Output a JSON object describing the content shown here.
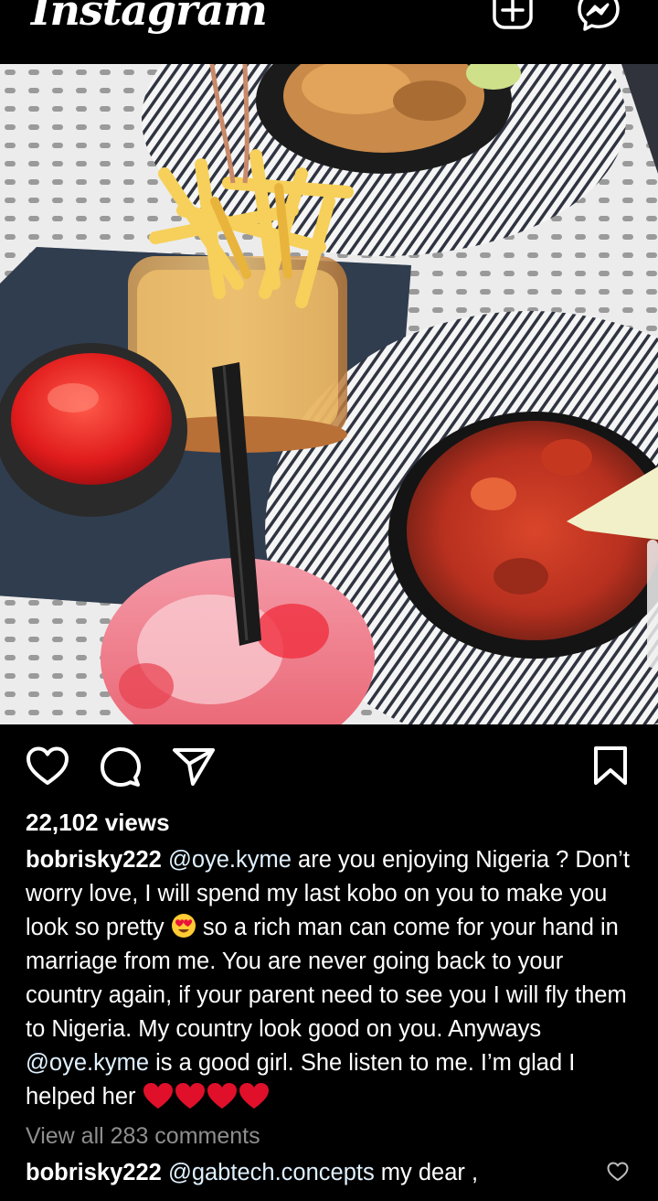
{
  "app": {
    "logo_text": "Instagram",
    "header_icons": [
      "add-post-icon",
      "messenger-icon"
    ]
  },
  "post": {
    "actions": [
      "heart-icon",
      "comment-icon",
      "share-icon",
      "bookmark-icon"
    ],
    "views": "22,102 views",
    "caption": {
      "username": "bobrisky222",
      "mention_1": "@oye.kyme",
      "text_1": " are you enjoying Nigeria ? Don’t worry love, I will spend my last kobo on you to make you look so pretty ",
      "emoji_1": "heart-eyes-emoji",
      "text_2": " so a rich man can come for your hand in marriage from me.  You are never going back to your country again, if your parent need to see you I will fly them to Nigeria. My country look good on you. Anyways ",
      "mention_2": "@oye.kyme",
      "text_3": " is a good girl. She listen to me. I’m glad I helped her ",
      "hearts": [
        "red-heart-emoji",
        "red-heart-emoji",
        "red-heart-emoji",
        "red-heart-emoji"
      ]
    },
    "view_all_comments": "View all 283 comments",
    "top_comment": {
      "username": "bobrisky222",
      "mention": "@gabtech.concepts",
      "text": " my dear ,"
    }
  },
  "colors": {
    "background": "#000000",
    "text": "#ffffff",
    "muted": "#8e8e8e",
    "mention": "#e0f1ff",
    "heart_red": "#e0102a"
  }
}
